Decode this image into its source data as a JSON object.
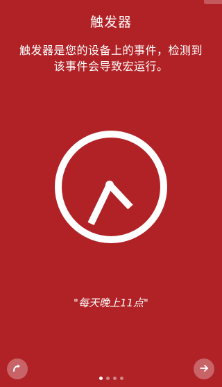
{
  "header": {
    "title": "触发器"
  },
  "intro": {
    "text": "触发器是您的设备上的事件，检测到该事件会导致宏运行。"
  },
  "illustration": {
    "icon": "clock-icon"
  },
  "caption": {
    "text": "\"每天晚上11点\""
  },
  "navigation": {
    "back_icon": "redo-arrow-icon",
    "next_icon": "arrow-right-icon",
    "page_count": 4,
    "current_page": 1
  },
  "colors": {
    "background": "#b02226",
    "foreground": "#ffffff"
  }
}
